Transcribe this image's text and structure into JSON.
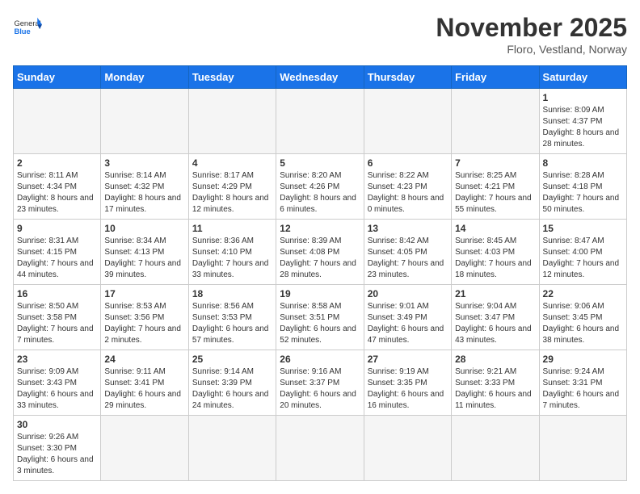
{
  "header": {
    "logo_general": "General",
    "logo_blue": "Blue",
    "month": "November 2025",
    "location": "Floro, Vestland, Norway"
  },
  "weekdays": [
    "Sunday",
    "Monday",
    "Tuesday",
    "Wednesday",
    "Thursday",
    "Friday",
    "Saturday"
  ],
  "days": [
    {
      "date": "",
      "empty": true
    },
    {
      "date": "",
      "empty": true
    },
    {
      "date": "",
      "empty": true
    },
    {
      "date": "",
      "empty": true
    },
    {
      "date": "",
      "empty": true
    },
    {
      "date": "",
      "empty": true
    },
    {
      "date": "1",
      "sunrise": "Sunrise: 8:09 AM",
      "sunset": "Sunset: 4:37 PM",
      "daylight": "Daylight: 8 hours and 28 minutes."
    },
    {
      "date": "2",
      "sunrise": "Sunrise: 8:11 AM",
      "sunset": "Sunset: 4:34 PM",
      "daylight": "Daylight: 8 hours and 23 minutes."
    },
    {
      "date": "3",
      "sunrise": "Sunrise: 8:14 AM",
      "sunset": "Sunset: 4:32 PM",
      "daylight": "Daylight: 8 hours and 17 minutes."
    },
    {
      "date": "4",
      "sunrise": "Sunrise: 8:17 AM",
      "sunset": "Sunset: 4:29 PM",
      "daylight": "Daylight: 8 hours and 12 minutes."
    },
    {
      "date": "5",
      "sunrise": "Sunrise: 8:20 AM",
      "sunset": "Sunset: 4:26 PM",
      "daylight": "Daylight: 8 hours and 6 minutes."
    },
    {
      "date": "6",
      "sunrise": "Sunrise: 8:22 AM",
      "sunset": "Sunset: 4:23 PM",
      "daylight": "Daylight: 8 hours and 0 minutes."
    },
    {
      "date": "7",
      "sunrise": "Sunrise: 8:25 AM",
      "sunset": "Sunset: 4:21 PM",
      "daylight": "Daylight: 7 hours and 55 minutes."
    },
    {
      "date": "8",
      "sunrise": "Sunrise: 8:28 AM",
      "sunset": "Sunset: 4:18 PM",
      "daylight": "Daylight: 7 hours and 50 minutes."
    },
    {
      "date": "9",
      "sunrise": "Sunrise: 8:31 AM",
      "sunset": "Sunset: 4:15 PM",
      "daylight": "Daylight: 7 hours and 44 minutes."
    },
    {
      "date": "10",
      "sunrise": "Sunrise: 8:34 AM",
      "sunset": "Sunset: 4:13 PM",
      "daylight": "Daylight: 7 hours and 39 minutes."
    },
    {
      "date": "11",
      "sunrise": "Sunrise: 8:36 AM",
      "sunset": "Sunset: 4:10 PM",
      "daylight": "Daylight: 7 hours and 33 minutes."
    },
    {
      "date": "12",
      "sunrise": "Sunrise: 8:39 AM",
      "sunset": "Sunset: 4:08 PM",
      "daylight": "Daylight: 7 hours and 28 minutes."
    },
    {
      "date": "13",
      "sunrise": "Sunrise: 8:42 AM",
      "sunset": "Sunset: 4:05 PM",
      "daylight": "Daylight: 7 hours and 23 minutes."
    },
    {
      "date": "14",
      "sunrise": "Sunrise: 8:45 AM",
      "sunset": "Sunset: 4:03 PM",
      "daylight": "Daylight: 7 hours and 18 minutes."
    },
    {
      "date": "15",
      "sunrise": "Sunrise: 8:47 AM",
      "sunset": "Sunset: 4:00 PM",
      "daylight": "Daylight: 7 hours and 12 minutes."
    },
    {
      "date": "16",
      "sunrise": "Sunrise: 8:50 AM",
      "sunset": "Sunset: 3:58 PM",
      "daylight": "Daylight: 7 hours and 7 minutes."
    },
    {
      "date": "17",
      "sunrise": "Sunrise: 8:53 AM",
      "sunset": "Sunset: 3:56 PM",
      "daylight": "Daylight: 7 hours and 2 minutes."
    },
    {
      "date": "18",
      "sunrise": "Sunrise: 8:56 AM",
      "sunset": "Sunset: 3:53 PM",
      "daylight": "Daylight: 6 hours and 57 minutes."
    },
    {
      "date": "19",
      "sunrise": "Sunrise: 8:58 AM",
      "sunset": "Sunset: 3:51 PM",
      "daylight": "Daylight: 6 hours and 52 minutes."
    },
    {
      "date": "20",
      "sunrise": "Sunrise: 9:01 AM",
      "sunset": "Sunset: 3:49 PM",
      "daylight": "Daylight: 6 hours and 47 minutes."
    },
    {
      "date": "21",
      "sunrise": "Sunrise: 9:04 AM",
      "sunset": "Sunset: 3:47 PM",
      "daylight": "Daylight: 6 hours and 43 minutes."
    },
    {
      "date": "22",
      "sunrise": "Sunrise: 9:06 AM",
      "sunset": "Sunset: 3:45 PM",
      "daylight": "Daylight: 6 hours and 38 minutes."
    },
    {
      "date": "23",
      "sunrise": "Sunrise: 9:09 AM",
      "sunset": "Sunset: 3:43 PM",
      "daylight": "Daylight: 6 hours and 33 minutes."
    },
    {
      "date": "24",
      "sunrise": "Sunrise: 9:11 AM",
      "sunset": "Sunset: 3:41 PM",
      "daylight": "Daylight: 6 hours and 29 minutes."
    },
    {
      "date": "25",
      "sunrise": "Sunrise: 9:14 AM",
      "sunset": "Sunset: 3:39 PM",
      "daylight": "Daylight: 6 hours and 24 minutes."
    },
    {
      "date": "26",
      "sunrise": "Sunrise: 9:16 AM",
      "sunset": "Sunset: 3:37 PM",
      "daylight": "Daylight: 6 hours and 20 minutes."
    },
    {
      "date": "27",
      "sunrise": "Sunrise: 9:19 AM",
      "sunset": "Sunset: 3:35 PM",
      "daylight": "Daylight: 6 hours and 16 minutes."
    },
    {
      "date": "28",
      "sunrise": "Sunrise: 9:21 AM",
      "sunset": "Sunset: 3:33 PM",
      "daylight": "Daylight: 6 hours and 11 minutes."
    },
    {
      "date": "29",
      "sunrise": "Sunrise: 9:24 AM",
      "sunset": "Sunset: 3:31 PM",
      "daylight": "Daylight: 6 hours and 7 minutes."
    },
    {
      "date": "30",
      "sunrise": "Sunrise: 9:26 AM",
      "sunset": "Sunset: 3:30 PM",
      "daylight": "Daylight: 6 hours and 3 minutes."
    }
  ]
}
